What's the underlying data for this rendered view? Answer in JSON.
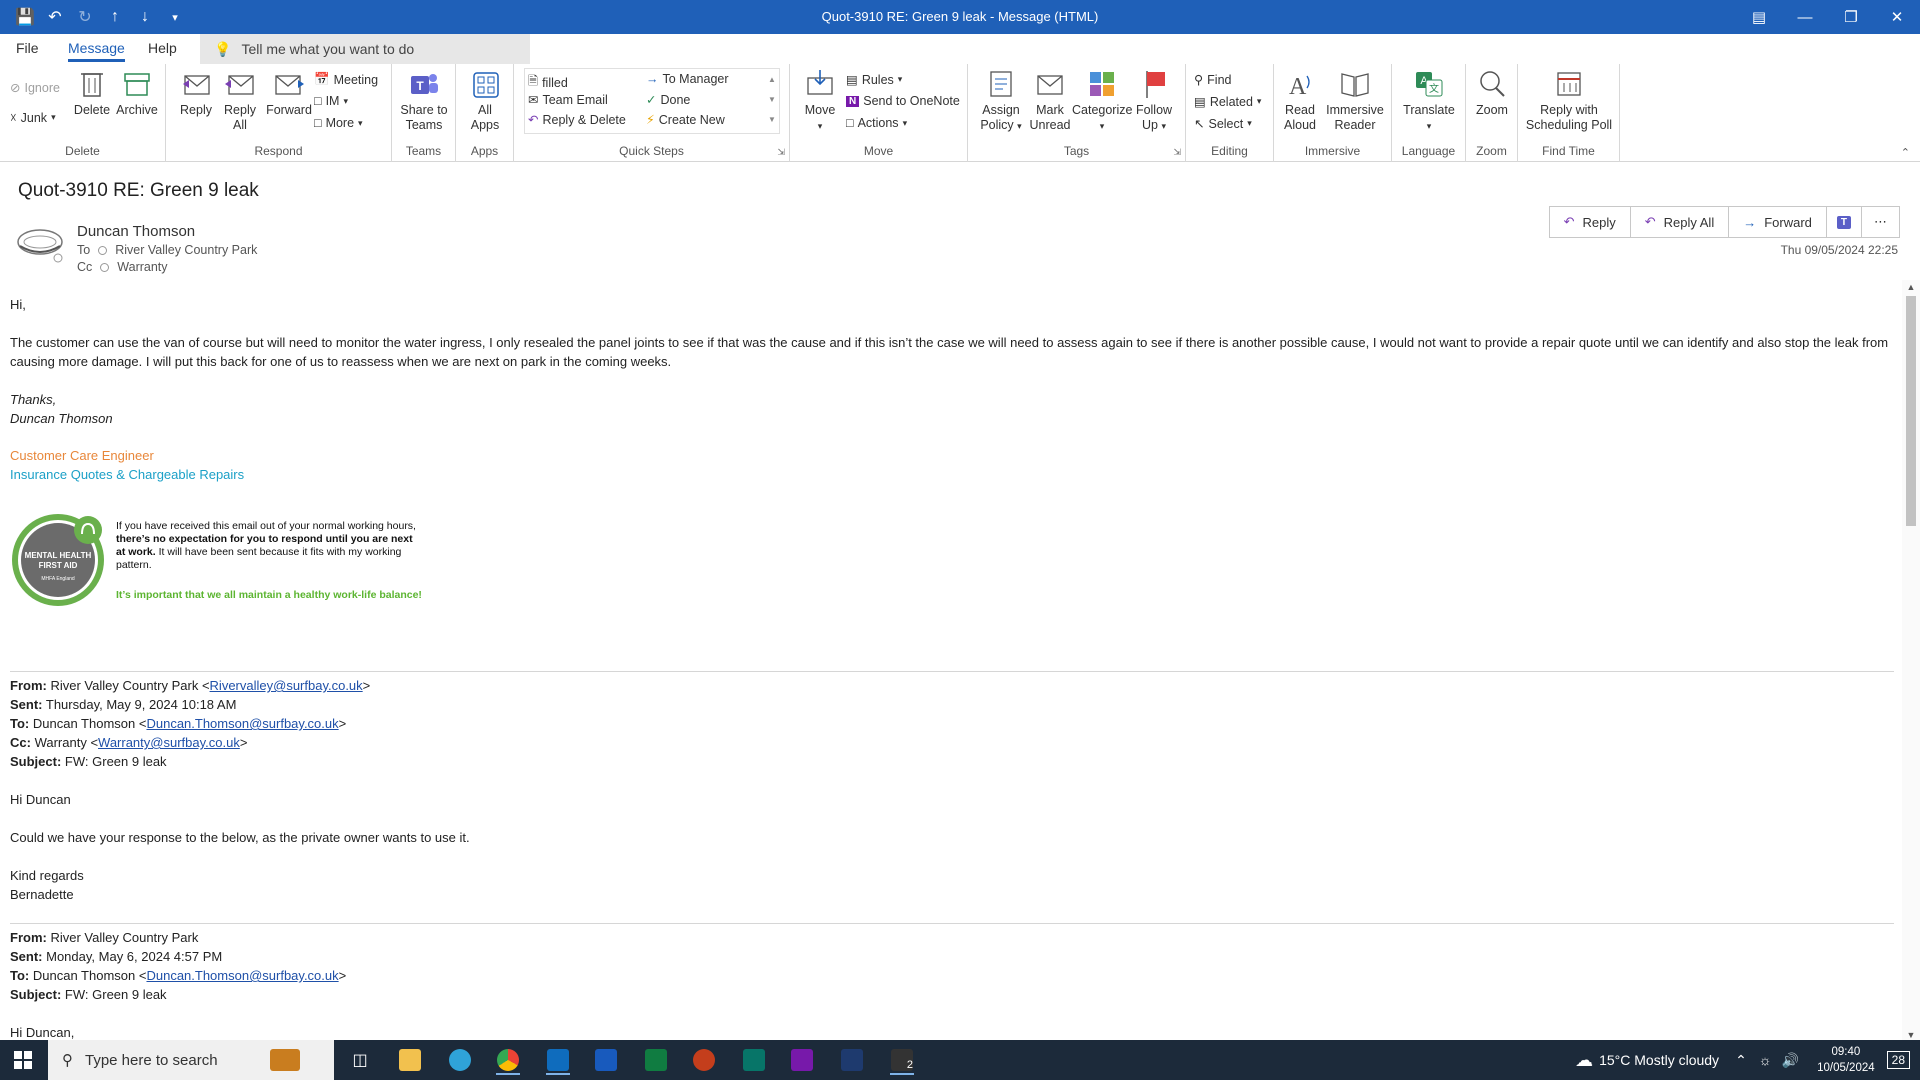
{
  "window": {
    "title": "Quot-3910 RE: Green 9 leak  -  Message (HTML)"
  },
  "menu": {
    "tabs": [
      "File",
      "Message",
      "Help"
    ],
    "tell_me": "Tell me what you want to do"
  },
  "ribbon": {
    "delete_group": {
      "label": "Delete",
      "ignore": "Ignore",
      "junk": "Junk",
      "delete": "Delete",
      "archive": "Archive"
    },
    "respond_group": {
      "label": "Respond",
      "reply": "Reply",
      "reply_all": "Reply All",
      "forward": "Forward",
      "meeting": "Meeting",
      "im": "IM",
      "more": "More"
    },
    "teams_group": {
      "label": "Teams",
      "share": "Share to Teams"
    },
    "apps_group": {
      "label": "Apps",
      "all_apps": "All Apps"
    },
    "quick_steps_group": {
      "label": "Quick Steps",
      "items": [
        "filled",
        "Team Email",
        "Reply & Delete",
        "To Manager",
        "Done",
        "Create New"
      ]
    },
    "move_group": {
      "label": "Move",
      "move": "Move",
      "rules": "Rules",
      "onenote": "Send to OneNote",
      "actions": "Actions"
    },
    "tags_group": {
      "label": "Tags",
      "assign_policy": "Assign Policy",
      "mark_unread": "Mark Unread",
      "categorize": "Categorize",
      "follow_up": "Follow Up"
    },
    "editing_group": {
      "label": "Editing",
      "find": "Find",
      "related": "Related",
      "select": "Select"
    },
    "immersive_group": {
      "label": "Immersive",
      "read_aloud": "Read Aloud",
      "immersive_reader": "Immersive Reader"
    },
    "language_group": {
      "label": "Language",
      "translate": "Translate"
    },
    "zoom_group": {
      "label": "Zoom",
      "zoom": "Zoom"
    },
    "find_time_group": {
      "label": "Find Time",
      "reply_poll": "Reply with Scheduling Poll"
    }
  },
  "message": {
    "subject": "Quot-3910 RE: Green 9 leak",
    "sender": "Duncan Thomson",
    "to_label": "To",
    "to": "River Valley Country Park",
    "cc_label": "Cc",
    "cc": "Warranty",
    "date": "Thu 09/05/2024 22:25",
    "actions": {
      "reply": "Reply",
      "reply_all": "Reply All",
      "forward": "Forward"
    }
  },
  "body": {
    "greeting": "Hi,",
    "paragraph": "The customer can use the van of course but will need to monitor the water ingress, I only resealed the panel joints to see if that was the cause and if this isn’t the case we will need to assess again to see if there is another possible cause, I would not want to provide a repair quote until we can identify and also stop the leak from causing more damage. I will put this back for one of us to reassess when we are next on park in the coming weeks.",
    "thanks": "Thanks,",
    "sign_name": "Duncan Thomson",
    "role": "Customer Care Engineer",
    "team": "Insurance Quotes & Chargeable Repairs",
    "mhfa_logo": {
      "line1": "MENTAL HEALTH",
      "line2": "FIRST AID",
      "line3": "MHFA England"
    },
    "mhfa_text_1": "If you have received this email out of your normal working hours, ",
    "mhfa_text_bold": "there’s no expectation for you to respond until you are next at work.",
    "mhfa_text_2": " It will have been sent because it fits with my working pattern.",
    "mhfa_green": "It’s important that we all maintain a healthy work-life balance!",
    "quote1": {
      "from_label": "From:",
      "from_name": "River Valley Country Park <",
      "from_email": "Rivervalley@surfbay.co.uk",
      "from_end": ">",
      "sent_label": "Sent:",
      "sent": "Thursday, May 9, 2024 10:18 AM",
      "to_label": "To:",
      "to_name": "Duncan Thomson <",
      "to_email": "Duncan.Thomson@surfbay.co.uk",
      "to_end": ">",
      "cc_label": "Cc:",
      "cc_name": "Warranty <",
      "cc_email": "Warranty@surfbay.co.uk",
      "cc_end": ">",
      "subject_label": "Subject:",
      "subject": "FW: Green 9 leak",
      "greeting": "Hi Duncan",
      "text": "Could we have your response to the below, as the private owner wants to use it.",
      "regards": "Kind regards",
      "name": "Bernadette"
    },
    "quote2": {
      "from_label": "From:",
      "from": "River Valley Country Park",
      "sent_label": "Sent:",
      "sent": "Monday, May 6, 2024 4:57 PM",
      "to_label": "To:",
      "to_name": "Duncan Thomson <",
      "to_email": "Duncan.Thomson@surfbay.co.uk",
      "to_end": ">",
      "subject_label": "Subject:",
      "subject": "FW: Green 9 leak",
      "greeting": "Hi Duncan,"
    }
  },
  "taskbar": {
    "search_placeholder": "Type here to search",
    "weather": "15°C  Mostly cloudy",
    "time": "09:40",
    "date": "10/05/2024",
    "notifications": "28",
    "badge": "2"
  },
  "colors": {
    "accent": "#1f60b8",
    "signature_role": "#e8873a",
    "signature_team": "#1ba0c7",
    "mhfa_green": "#5cb531"
  }
}
